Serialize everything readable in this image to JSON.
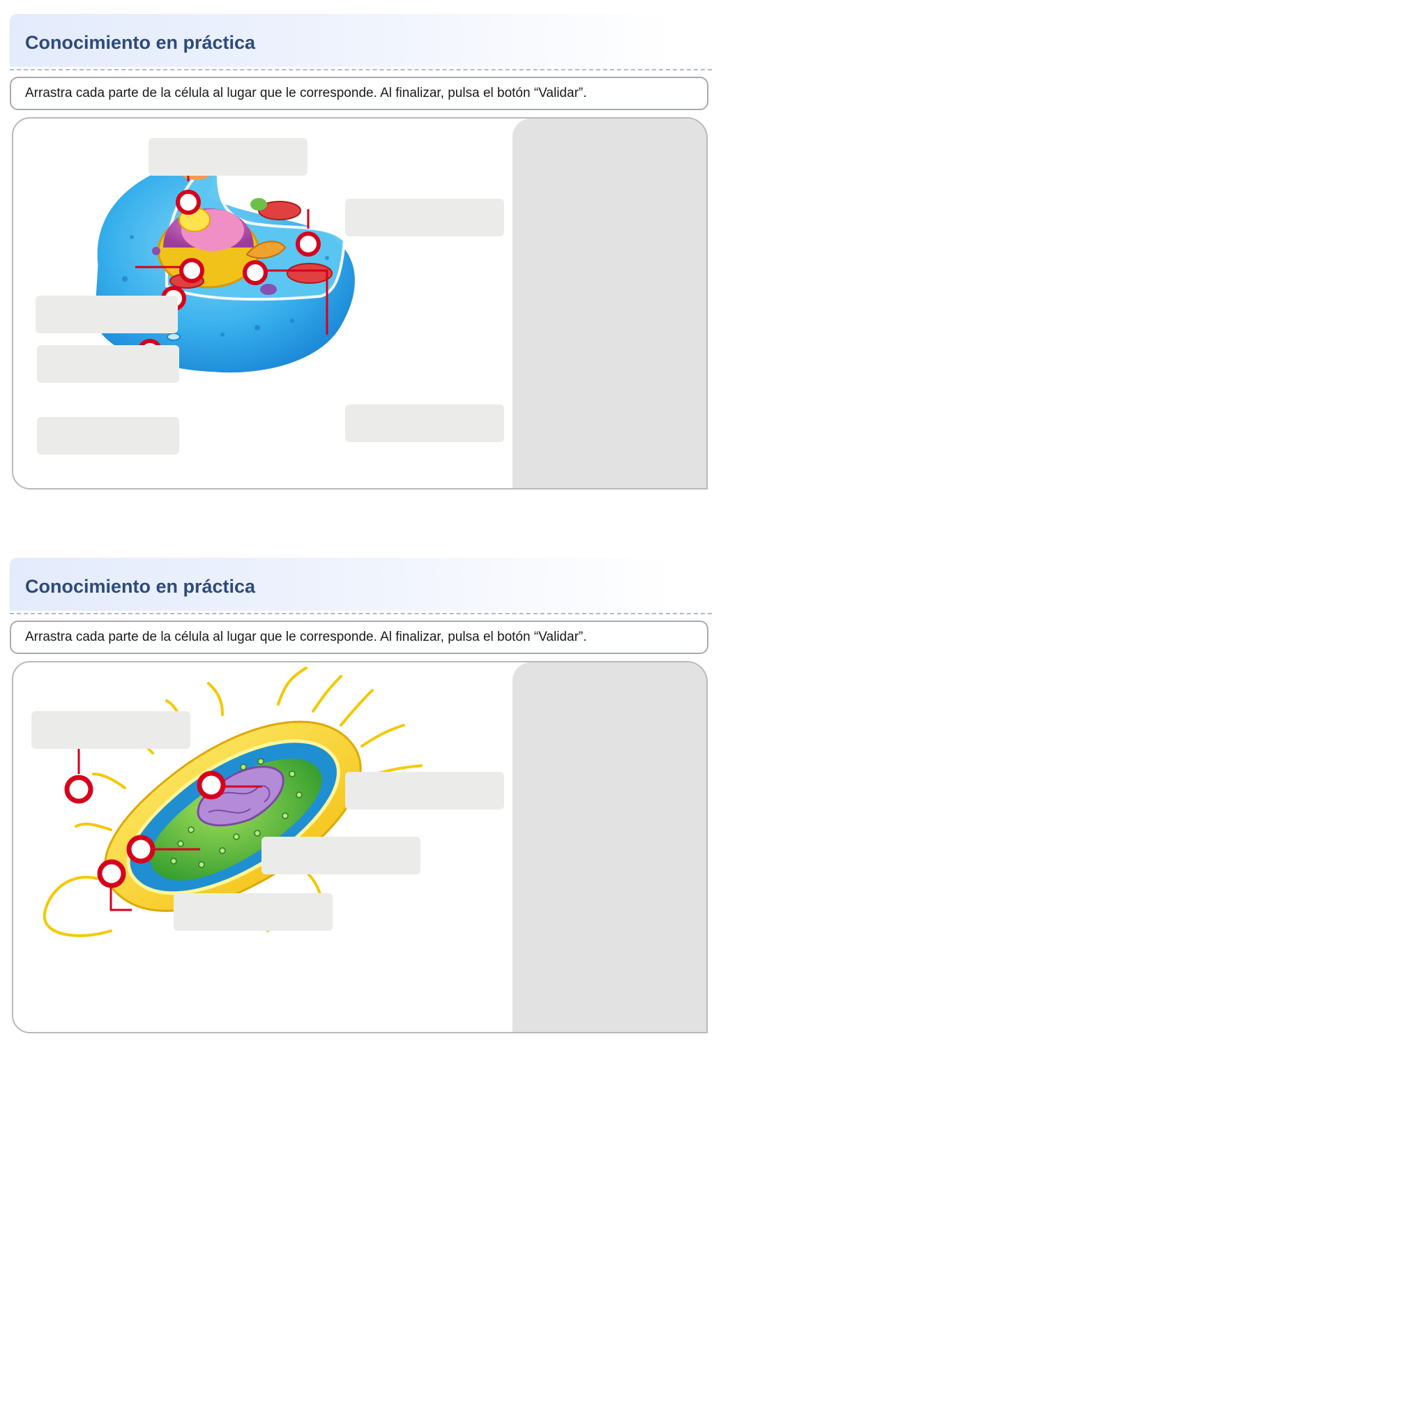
{
  "activities": [
    {
      "header": {
        "title": "Conocimiento en práctica"
      },
      "instructions": "Arrastra cada parte de la célula al lugar que le corresponde. Al finalizar, pulsa el botón “Validar”.",
      "diagram": {
        "image": "animal-cell-illustration",
        "slot_count": 6,
        "answer_bank_count": 0
      }
    },
    {
      "header": {
        "title": "Conocimiento en práctica"
      },
      "instructions": "Arrastra cada parte de la célula al lugar que le corresponde. Al finalizar, pulsa el botón “Validar”.",
      "diagram": {
        "image": "bacterial-cell-illustration",
        "slot_count": 4,
        "answer_bank_count": 0
      }
    }
  ],
  "colors": {
    "accent_red": "#d6001c",
    "title_blue": "#2e4a7b",
    "slot_gray": "#ebecea",
    "bank_gray": "#e1e2e1"
  }
}
